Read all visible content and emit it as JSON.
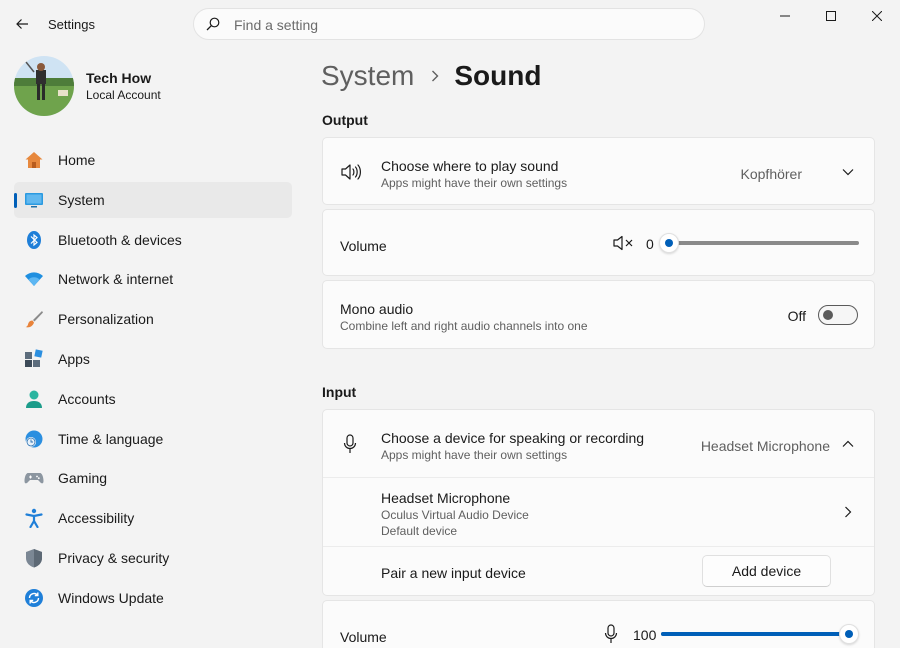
{
  "window": {
    "app_title": "Settings",
    "search_placeholder": "Find a setting"
  },
  "profile": {
    "name": "Tech How",
    "account_type": "Local Account"
  },
  "sidebar": {
    "items": [
      {
        "label": "Home",
        "icon": "home-icon",
        "active": false
      },
      {
        "label": "System",
        "icon": "system-icon",
        "active": true
      },
      {
        "label": "Bluetooth & devices",
        "icon": "bluetooth-icon",
        "active": false
      },
      {
        "label": "Network & internet",
        "icon": "wifi-icon",
        "active": false
      },
      {
        "label": "Personalization",
        "icon": "brush-icon",
        "active": false
      },
      {
        "label": "Apps",
        "icon": "apps-icon",
        "active": false
      },
      {
        "label": "Accounts",
        "icon": "person-icon",
        "active": false
      },
      {
        "label": "Time & language",
        "icon": "clock-globe-icon",
        "active": false
      },
      {
        "label": "Gaming",
        "icon": "gamepad-icon",
        "active": false
      },
      {
        "label": "Accessibility",
        "icon": "accessibility-icon",
        "active": false
      },
      {
        "label": "Privacy & security",
        "icon": "shield-icon",
        "active": false
      },
      {
        "label": "Windows Update",
        "icon": "update-icon",
        "active": false
      }
    ]
  },
  "breadcrumb": {
    "parent": "System",
    "current": "Sound"
  },
  "output": {
    "section_title": "Output",
    "device_title": "Choose where to play sound",
    "device_subtitle": "Apps might have their own settings",
    "device_value": "Kopfhörer",
    "volume_label": "Volume",
    "volume_value": "0",
    "volume_fraction": 0,
    "mono_title": "Mono audio",
    "mono_subtitle": "Combine left and right audio channels into one",
    "mono_state": "Off"
  },
  "input": {
    "section_title": "Input",
    "device_title": "Choose a device for speaking or recording",
    "device_subtitle": "Apps might have their own settings",
    "device_value": "Headset Microphone",
    "mic_name": "Headset Microphone",
    "mic_detail": "Oculus Virtual Audio Device",
    "mic_default": "Default device",
    "pair_label": "Pair a new input device",
    "add_button": "Add device",
    "volume_label": "Volume",
    "volume_value": "100",
    "volume_fraction": 1
  },
  "colors": {
    "accent": "#005fb8",
    "background": "#f3f3f3",
    "card": "#fbfbfb"
  }
}
